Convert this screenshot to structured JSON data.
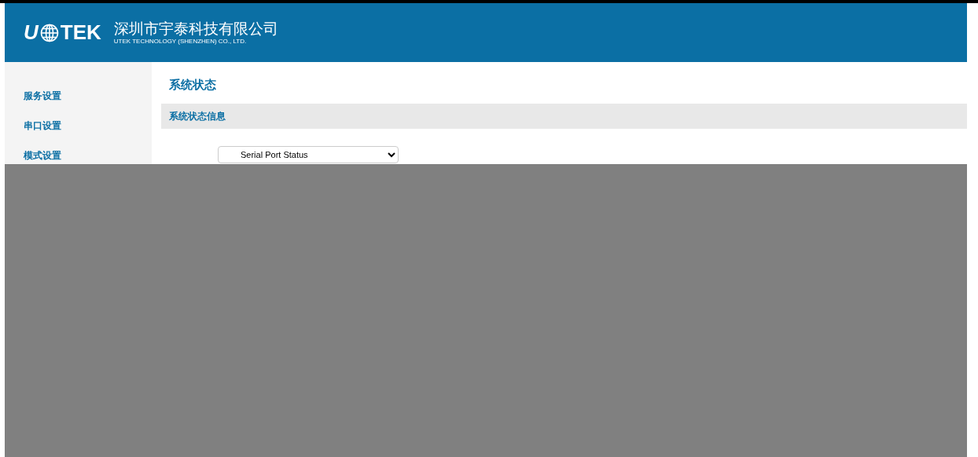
{
  "header": {
    "logo_left": "U",
    "logo_right": "TEK",
    "company_cn": "深圳市宇泰科技有限公司",
    "company_en": "UTEK TECHNOLOGY (SHENZHEN) CO., LTD."
  },
  "sidebar": {
    "items": [
      {
        "label": "服务设置"
      },
      {
        "label": "串口设置"
      },
      {
        "label": "模式设置"
      }
    ]
  },
  "page_title": "系统状态",
  "section_title": "系统状态信息",
  "status_select": {
    "value": "Serial Port Status"
  }
}
